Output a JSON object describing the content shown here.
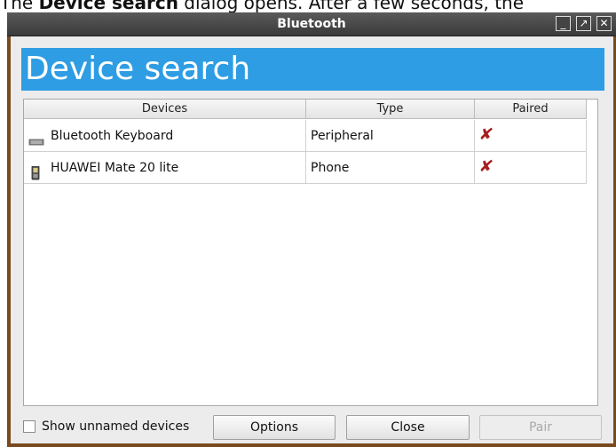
{
  "caption": {
    "prefix": "The ",
    "bold": "Device search",
    "suffix": " dialog opens. After a few seconds, the"
  },
  "window": {
    "title": "Bluetooth",
    "controls": {
      "minimize": "_",
      "maximize": "↗",
      "close": "✕"
    }
  },
  "heading": "Device search",
  "table": {
    "columns": [
      "Devices",
      "Type",
      "Paired"
    ],
    "rows": [
      {
        "device": "Bluetooth Keyboard",
        "icon": "keyboard-icon",
        "type": "Peripheral",
        "paired": "✘"
      },
      {
        "device": "HUAWEI Mate 20 lite",
        "icon": "phone-icon",
        "type": "Phone",
        "paired": "✘"
      }
    ]
  },
  "footer": {
    "show_unnamed_label": "Show unnamed devices",
    "show_unnamed_checked": false,
    "options_label": "Options",
    "close_label": "Close",
    "pair_label": "Pair"
  },
  "colors": {
    "heading_bg": "#2e9de3",
    "paired_x": "#a51f1f",
    "window_frame": "#7a4a1e"
  }
}
